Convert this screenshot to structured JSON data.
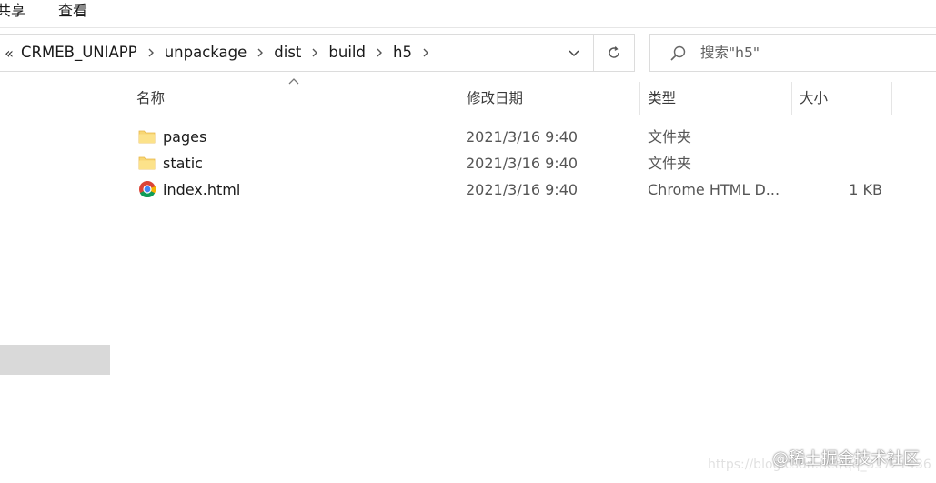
{
  "ribbon": {
    "tabs": [
      {
        "label": "共享"
      },
      {
        "label": "查看"
      }
    ]
  },
  "address_bar": {
    "overflow_glyph": "«",
    "crumbs": [
      {
        "label": "CRMEB_UNIAPP"
      },
      {
        "label": "unpackage"
      },
      {
        "label": "dist"
      },
      {
        "label": "build"
      },
      {
        "label": "h5"
      }
    ]
  },
  "search": {
    "placeholder": "搜索\"h5\""
  },
  "columns": {
    "name": "名称",
    "date": "修改日期",
    "type": "类型",
    "size": "大小"
  },
  "files": [
    {
      "name": "pages",
      "date": "2021/3/16 9:40",
      "type": "文件夹",
      "size": "",
      "icon": "folder-icon"
    },
    {
      "name": "static",
      "date": "2021/3/16 9:40",
      "type": "文件夹",
      "size": "",
      "icon": "folder-icon"
    },
    {
      "name": "index.html",
      "date": "2021/3/16 9:40",
      "type": "Chrome HTML D...",
      "size": "1 KB",
      "icon": "chrome-icon"
    }
  ],
  "watermark": {
    "brand": "@稀土掘金技术社区",
    "url": "https://blog.csdn.net/qq_33721436"
  },
  "colors": {
    "folder": "#F8D775",
    "folder_dark": "#E8B84A",
    "nav_selected": "#D9D9D9",
    "border": "#DCDCDC"
  }
}
